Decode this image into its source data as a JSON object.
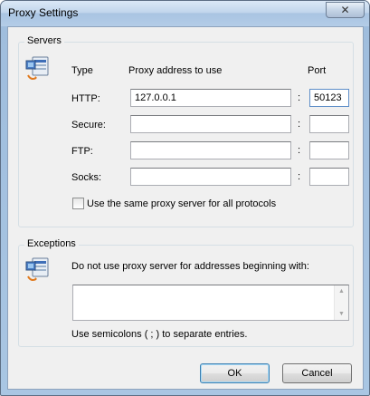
{
  "window": {
    "title": "Proxy Settings",
    "close_glyph": "✕"
  },
  "servers": {
    "group_label": "Servers",
    "headers": {
      "type": "Type",
      "address": "Proxy address to use",
      "port": "Port"
    },
    "separator": ":",
    "rows": [
      {
        "type": "HTTP:",
        "address": "127.0.0.1",
        "port": "50123"
      },
      {
        "type": "Secure:",
        "address": "",
        "port": ""
      },
      {
        "type": "FTP:",
        "address": "",
        "port": ""
      },
      {
        "type": "Socks:",
        "address": "",
        "port": ""
      }
    ],
    "same_proxy_label": "Use the same proxy server for all protocols",
    "same_proxy_checked": false,
    "icon": "network-computer-icon"
  },
  "exceptions": {
    "group_label": "Exceptions",
    "description": "Do not use proxy server for addresses beginning with:",
    "value": "",
    "hint": "Use semicolons ( ; ) to separate entries.",
    "icon": "network-computer-icon"
  },
  "buttons": {
    "ok": "OK",
    "cancel": "Cancel"
  },
  "colors": {
    "title_bar": "#b9d1ea",
    "client_bg": "#f0f0f0",
    "focus_border": "#5e8ec8"
  }
}
